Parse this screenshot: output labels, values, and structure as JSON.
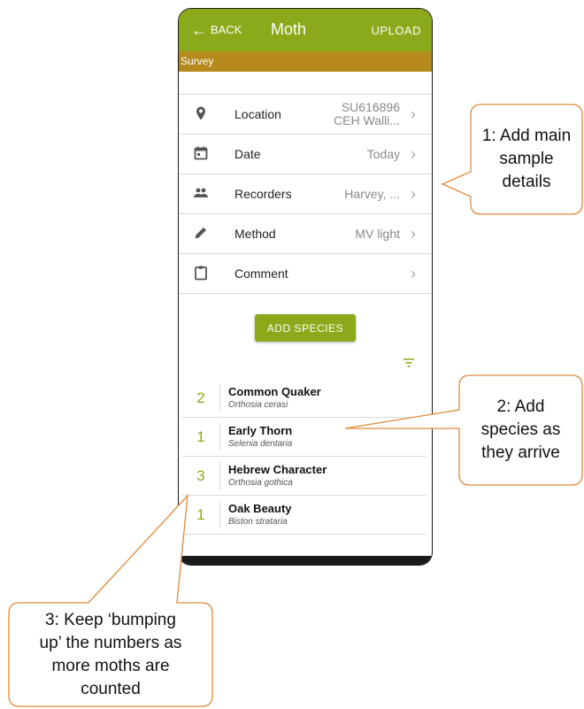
{
  "appbar": {
    "back_label": "BACK",
    "title": "Moth",
    "upload_label": "UPLOAD"
  },
  "survey_label": "Survey",
  "details": [
    {
      "label": "Location",
      "value_line1": "SU616896",
      "value_line2": "CEH Walli...",
      "icon": "location-pin-icon"
    },
    {
      "label": "Date",
      "value_line1": "Today",
      "value_line2": "",
      "icon": "calendar-icon"
    },
    {
      "label": "Recorders",
      "value_line1": "Harvey, ...",
      "value_line2": "",
      "icon": "people-icon"
    },
    {
      "label": "Method",
      "value_line1": "MV light",
      "value_line2": "",
      "icon": "pencil-icon"
    },
    {
      "label": "Comment",
      "value_line1": "",
      "value_line2": "",
      "icon": "clipboard-icon"
    }
  ],
  "add_species_label": "ADD SPECIES",
  "species": [
    {
      "count": "2",
      "name": "Common Quaker",
      "latin": "Orthosia cerasi"
    },
    {
      "count": "1",
      "name": "Early Thorn",
      "latin": "Selenia dentaria"
    },
    {
      "count": "3",
      "name": "Hebrew Character",
      "latin": "Orthosia gothica"
    },
    {
      "count": "1",
      "name": "Oak Beauty",
      "latin": "Biston strataria"
    }
  ],
  "annotations": {
    "c1_line1": "1: Add main",
    "c1_line2": "sample",
    "c1_line3": "details",
    "c2_line1": "2: Add",
    "c2_line2": "species as",
    "c2_line3": "they arrive",
    "c3_line1": "3: Keep ‘bumping",
    "c3_line2": "up’ the numbers as",
    "c3_line3": "more moths are",
    "c3_line4": "counted"
  },
  "colors": {
    "appbar": "#8aaa1c",
    "survey_bar": "#b5891c",
    "callout_border": "#e08a3a"
  }
}
